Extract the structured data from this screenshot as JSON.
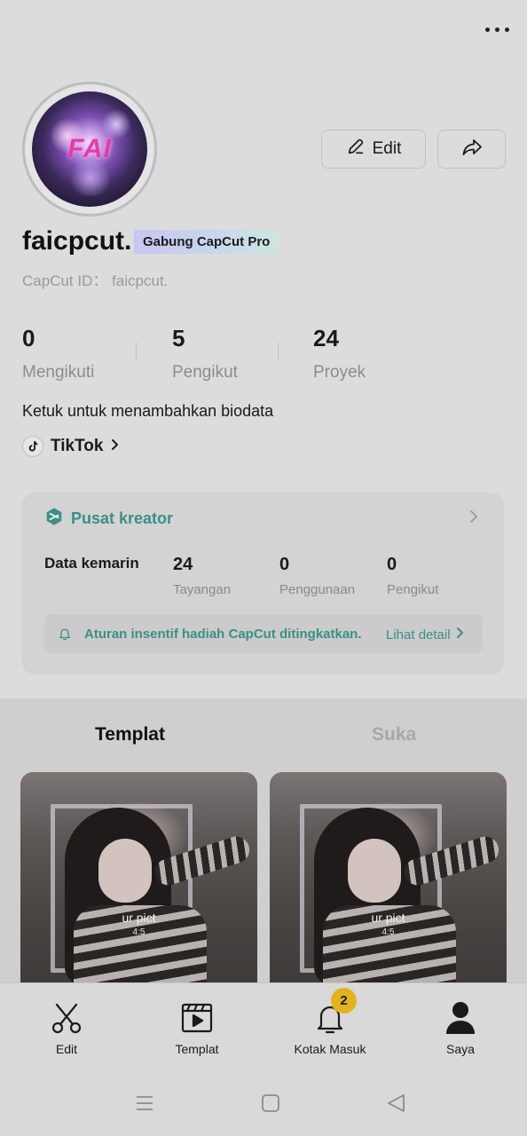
{
  "header": {
    "more_icon": "more-horizontal-icon"
  },
  "profile": {
    "avatar_text": "FAI",
    "username": "faicpcut.",
    "pro_badge": "Gabung CapCut Pro",
    "capcut_id": "CapCut ID： faicpcut.",
    "edit_label": "Edit",
    "bio": "Ketuk untuk menambahkan biodata",
    "tiktok_label": "TikTok"
  },
  "stats": [
    {
      "value": "0",
      "label": "Mengikuti"
    },
    {
      "value": "5",
      "label": "Pengikut"
    },
    {
      "value": "24",
      "label": "Proyek"
    }
  ],
  "creator": {
    "title": "Pusat kreator",
    "data_label": "Data kemarin",
    "stats": [
      {
        "value": "24",
        "label": "Tayangan"
      },
      {
        "value": "0",
        "label": "Penggunaan"
      },
      {
        "value": "0",
        "label": "Pengikut"
      }
    ],
    "notice": "Aturan insentif hadiah CapCut ditingkatkan.",
    "notice_link": "Lihat detail"
  },
  "tabs": [
    {
      "label": "Templat",
      "active": true
    },
    {
      "label": "Suka",
      "active": false
    }
  ],
  "templates": [
    {
      "caption": "ur pict",
      "ratio": "4:5"
    },
    {
      "caption": "ur pict",
      "ratio": "4:5"
    }
  ],
  "bottom_nav": [
    {
      "label": "Edit",
      "icon": "scissors-icon"
    },
    {
      "label": "Templat",
      "icon": "template-play-icon"
    },
    {
      "label": "Kotak Masuk",
      "icon": "bell-icon",
      "badge": "2"
    },
    {
      "label": "Saya",
      "icon": "person-icon",
      "active": true
    }
  ],
  "colors": {
    "accent": "#3b8f86",
    "badge": "#e2b31d",
    "background": "#dcdcdc"
  }
}
